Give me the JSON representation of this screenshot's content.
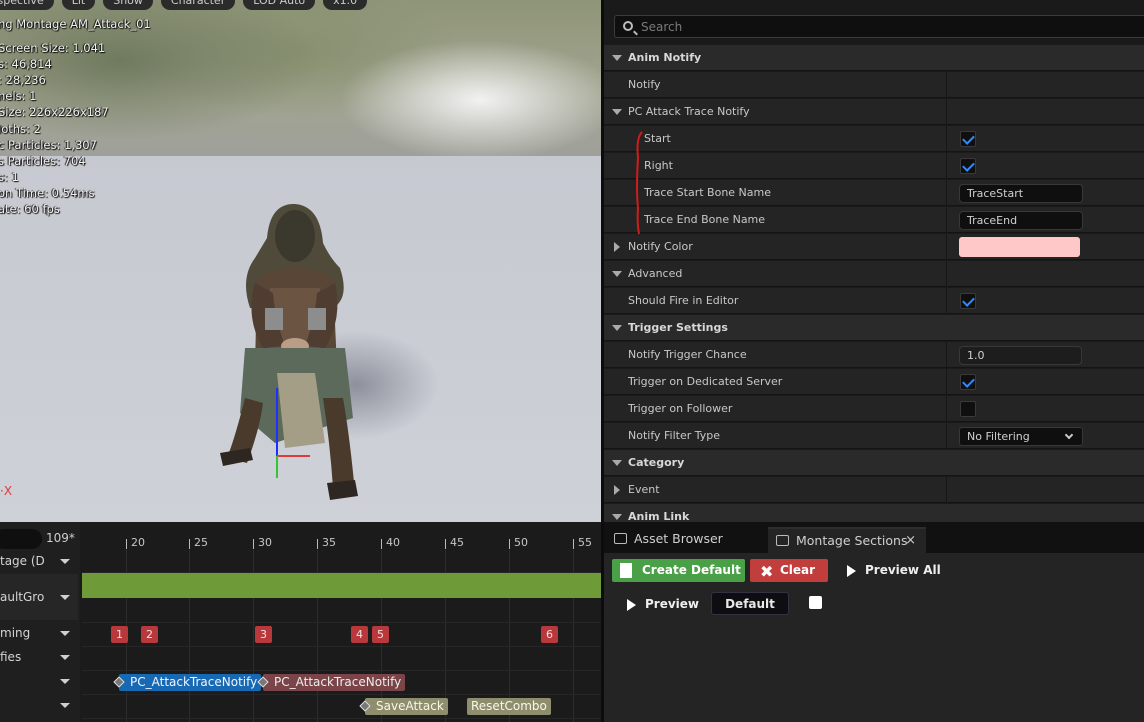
{
  "viewport": {
    "toolbar": [
      "Perspective",
      "Lit",
      "Show",
      "Character",
      "LOD Auto",
      "x1.0"
    ],
    "stats": [
      "ng Montage AM_Attack_01",
      "Screen Size: 1.041",
      "s: 46,814",
      ": 28,236",
      "nels: 1",
      "Size: 226x226x187",
      "loths: 2",
      "c Particles: 1,307",
      "s Particles: 704",
      "s: 1",
      "on Time: 0.54ms",
      "ate: 60 fps"
    ],
    "axis_label": "X"
  },
  "timeline": {
    "count": "109*",
    "rows": [
      "tage (D",
      "aultGro",
      "ming",
      "fies",
      "",
      ""
    ],
    "ticks": [
      "20",
      "25",
      "30",
      "35",
      "40",
      "45",
      "50",
      "55"
    ],
    "markers": [
      "1",
      "2",
      "3",
      "4",
      "5",
      "6"
    ],
    "notifies": [
      "PC_AttackTraceNotify",
      "PC_AttackTraceNotify",
      "SaveAttack",
      "ResetCombo"
    ]
  },
  "details": {
    "search_placeholder": "Search",
    "rows": [
      {
        "label": "Anim Notify"
      },
      {
        "label": "Notify"
      },
      {
        "label": "PC Attack Trace Notify"
      },
      {
        "label": "Start",
        "checked": true
      },
      {
        "label": "Right",
        "checked": true
      },
      {
        "label": "Trace Start Bone Name",
        "value": "TraceStart"
      },
      {
        "label": "Trace End Bone Name",
        "value": "TraceEnd"
      },
      {
        "label": "Notify Color",
        "color": "#ffc8c8"
      },
      {
        "label": "Advanced"
      },
      {
        "label": "Should Fire in Editor",
        "checked": true
      },
      {
        "label": "Trigger Settings"
      },
      {
        "label": "Notify Trigger Chance",
        "value": "1.0"
      },
      {
        "label": "Trigger on Dedicated Server",
        "checked": true
      },
      {
        "label": "Trigger on Follower",
        "checked": false
      },
      {
        "label": "Notify Filter Type",
        "value": "No Filtering"
      },
      {
        "label": "Category"
      },
      {
        "label": "Event"
      },
      {
        "label": "Anim Link"
      }
    ]
  },
  "sections_panel": {
    "tabs": [
      "Asset Browser",
      "Montage Sections"
    ],
    "create_default": "Create Default",
    "clear": "Clear",
    "preview_all": "Preview All",
    "preview": "Preview",
    "default_section": "Default",
    "tab_close": "×"
  },
  "colors": {
    "accent_blue": "#1869b4",
    "green_track": "#6e9b37",
    "marker_red": "#b8383c",
    "notify_color": "#ffc8c8"
  }
}
